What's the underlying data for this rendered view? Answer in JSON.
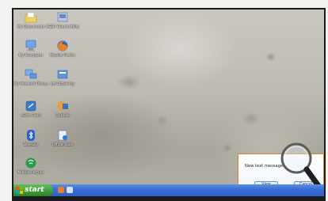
{
  "desktop": {
    "icons": [
      {
        "label": "My Documents"
      },
      {
        "label": "USBC Client Utility"
      },
      {
        "label": "My Computer"
      },
      {
        "label": "Mozilla Firefox"
      },
      {
        "label": "My Network Places"
      },
      {
        "label": "Jet Obtaining"
      },
      {
        "label": "eSafe Tools"
      },
      {
        "label": "Outlook"
      },
      {
        "label": "BlueSky"
      },
      {
        "label": "Office Tools"
      },
      {
        "label": "Mobile Partner"
      }
    ]
  },
  "taskbar": {
    "start_label": "start"
  },
  "notification": {
    "message": "New text message",
    "view_label": "View",
    "cancel_label": "Cancel"
  },
  "colors": {
    "taskbar": "#3a6fd6",
    "start_button": "#3c9b36",
    "notification_border": "#e2801f"
  }
}
